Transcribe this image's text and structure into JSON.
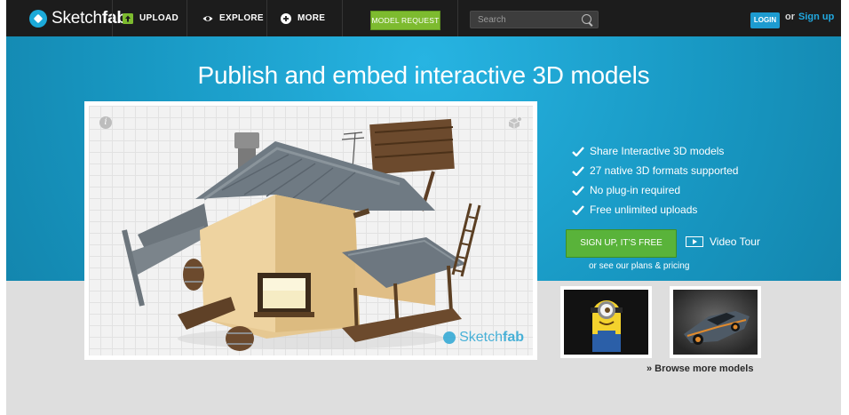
{
  "logo": {
    "brand_prefix": "Sketch",
    "brand_suffix": "fab"
  },
  "nav": {
    "upload": "UPLOAD",
    "explore": "EXPLORE",
    "more": "MORE",
    "model_request": "MODEL REQUEST"
  },
  "search": {
    "placeholder": "Search"
  },
  "auth": {
    "login": "LOGIN",
    "or": "or",
    "signup": "Sign up"
  },
  "hero": {
    "headline": "Publish and embed interactive 3D models",
    "features": [
      "Share Interactive 3D models",
      "27 native 3D formats supported",
      "No plug-in required",
      "Free unlimited uploads"
    ],
    "cta_label": "SIGN UP, IT’S FREE",
    "video_tour": "Video Tour",
    "pricing_link": "or see our plans & pricing"
  },
  "viewer": {
    "watermark_prefix": "Sketch",
    "watermark_suffix": "fab"
  },
  "browse": {
    "label": "» Browse more models"
  },
  "colors": {
    "topbar": "#1c1c1c",
    "hero_blue": "#1d9cc4",
    "accent_green": "#59b33a",
    "model_request_green": "#7dbb2f",
    "login_blue": "#1d9bd0"
  }
}
